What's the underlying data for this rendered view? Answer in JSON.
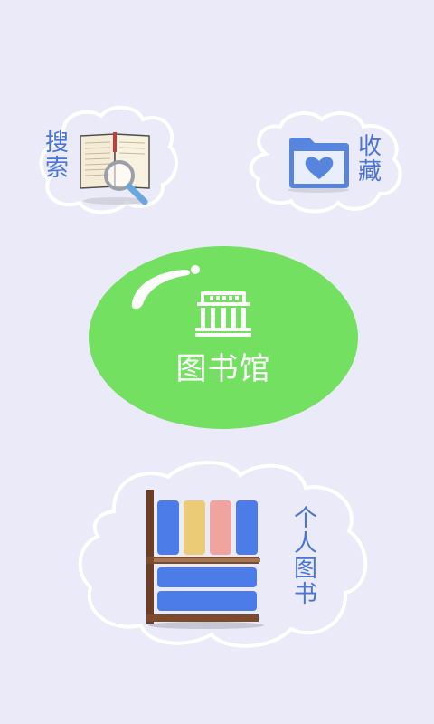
{
  "menu": {
    "search_label": "搜\n索",
    "favorites_label": "收\n藏",
    "library_label": "图书馆",
    "my_books_label": "个\n人\n图\n书"
  },
  "colors": {
    "background": "#eaeaf8",
    "library_green": "#74e061",
    "label_blue": "#4a74d6",
    "cloud_white": "#ffffff"
  },
  "icons": {
    "search": "book-magnifier-icon",
    "favorites": "folder-heart-icon",
    "library": "library-building-icon",
    "my_books": "bookshelf-icon"
  }
}
